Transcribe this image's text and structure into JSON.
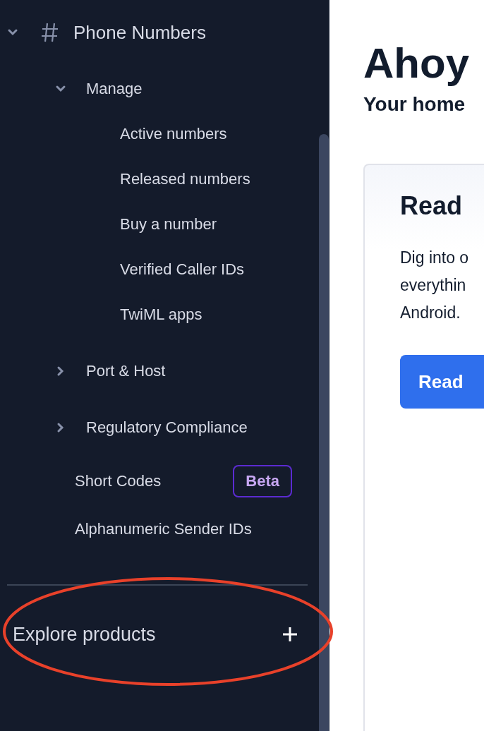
{
  "sidebar": {
    "items": [
      {
        "label": "Phone Numbers",
        "kind": "group",
        "expanded": true,
        "children": [
          {
            "label": "Manage",
            "kind": "group",
            "expanded": true,
            "children": [
              {
                "label": "Active numbers",
                "kind": "leaf"
              },
              {
                "label": "Released numbers",
                "kind": "leaf"
              },
              {
                "label": "Buy a number",
                "kind": "leaf"
              },
              {
                "label": "Verified Caller IDs",
                "kind": "leaf"
              },
              {
                "label": "TwiML apps",
                "kind": "leaf"
              }
            ]
          },
          {
            "label": "Port & Host",
            "kind": "group",
            "expanded": false
          },
          {
            "label": "Regulatory Compliance",
            "kind": "group",
            "expanded": false
          },
          {
            "label": "Short Codes",
            "kind": "link",
            "badge": "Beta"
          },
          {
            "label": "Alphanumeric Sender IDs",
            "kind": "link"
          }
        ]
      }
    ],
    "footer": {
      "label": "Explore products"
    }
  },
  "main": {
    "title": "Ahoy",
    "subtitle": "Your home",
    "card": {
      "title": "Read",
      "text": "Dig into o\neverythin\nAndroid.",
      "button": "Read"
    }
  },
  "annotations": [
    {
      "kind": "ellipse"
    }
  ]
}
